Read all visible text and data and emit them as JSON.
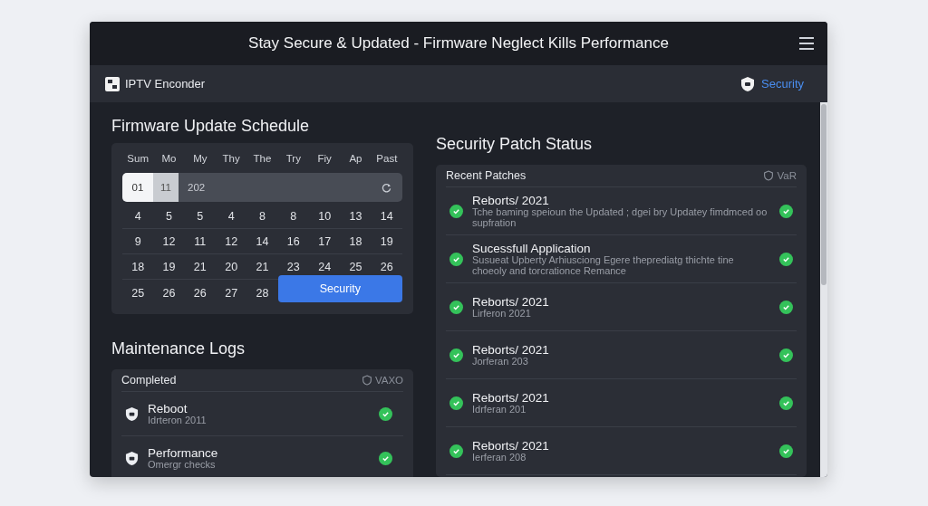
{
  "window": {
    "title": "Stay Secure & Updated - Firmware Neglect Kills Performance"
  },
  "nav": {
    "app_name": "IPTV Enconder",
    "link": "Security"
  },
  "schedule": {
    "title": "Firmware Update Schedule",
    "weekdays": [
      "Sum",
      "Mo",
      "My",
      "Thy",
      "The",
      "Try",
      "Fiy",
      "Ap",
      "Past"
    ],
    "date_field": {
      "day": "01",
      "month": "11",
      "year": "202"
    },
    "weeks": [
      [
        "4",
        "5",
        "5",
        "4",
        "8",
        "8",
        "10",
        "13",
        "14"
      ],
      [
        "9",
        "12",
        "11",
        "12",
        "14",
        "16",
        "17",
        "18",
        "19"
      ],
      [
        "18",
        "19",
        "21",
        "20",
        "21",
        "23",
        "24",
        "25",
        "26"
      ],
      [
        "25",
        "26",
        "26",
        "27",
        "28"
      ]
    ],
    "button": "Security"
  },
  "logs": {
    "title": "Maintenance Logs",
    "header": "Completed",
    "badge": "VAXO",
    "items": [
      {
        "title": "Reboot",
        "subtitle": "Idrteron 2011",
        "done": true
      },
      {
        "title": "Performance",
        "subtitle": "Omergr checks",
        "done": true
      }
    ]
  },
  "patches": {
    "title": "Security Patch Status",
    "header": "Recent Patches",
    "badge": "VaR",
    "items": [
      {
        "title": "Reborts/ 2021",
        "subtitle": "Tche baming speioun the Updated ; dgei bry Updatey fimdmced oo supfration",
        "done": true
      },
      {
        "title": "Sucessfull Application",
        "subtitle": "Susueat Upberty Arhiusciong Egere theprediatg thichte tine choeoly and torcrationce Remance",
        "done": true
      },
      {
        "title": "Reborts/ 2021",
        "subtitle": "Lirferon 2021",
        "done": true
      },
      {
        "title": "Reborts/ 2021",
        "subtitle": "Jorferan 203",
        "done": true
      },
      {
        "title": "Reborts/ 2021",
        "subtitle": "Idrferan 201",
        "done": true
      },
      {
        "title": "Reborts/ 2021",
        "subtitle": "Ierferan 208",
        "done": true
      }
    ]
  }
}
